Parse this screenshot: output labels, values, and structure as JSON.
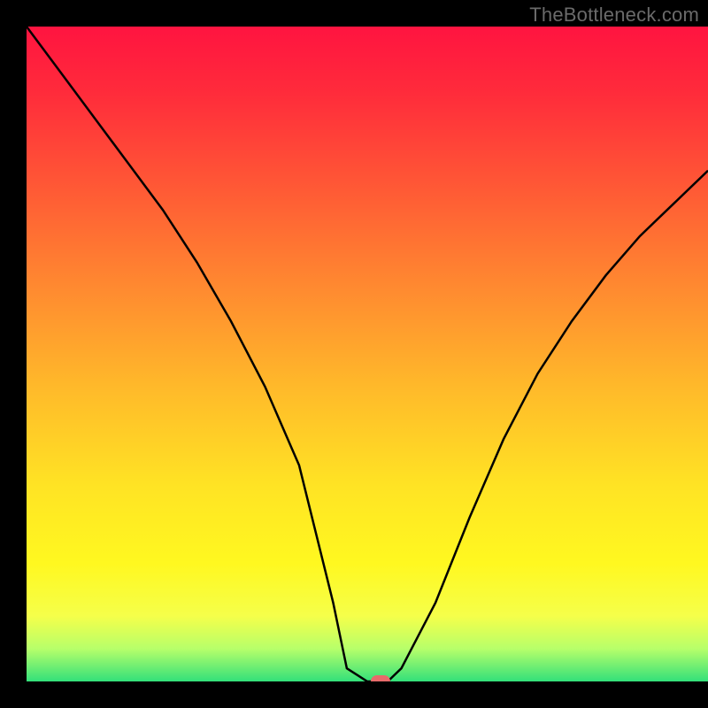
{
  "watermark": "TheBottleneck.com",
  "chart_data": {
    "type": "line",
    "title": "",
    "xlabel": "",
    "ylabel": "",
    "xlim": [
      0,
      100
    ],
    "ylim": [
      0,
      100
    ],
    "x": [
      0,
      5,
      10,
      15,
      20,
      25,
      30,
      35,
      40,
      45,
      47,
      50,
      53,
      55,
      58,
      60,
      65,
      70,
      75,
      80,
      85,
      90,
      95,
      100
    ],
    "values": [
      100,
      93,
      86,
      79,
      72,
      64,
      55,
      45,
      33,
      12,
      2,
      0,
      0,
      2,
      8,
      12,
      25,
      37,
      47,
      55,
      62,
      68,
      73,
      78
    ],
    "marker": {
      "x": 52,
      "y": 0
    },
    "gradient_stops": [
      {
        "pos": 0.0,
        "color": "#ff1440"
      },
      {
        "pos": 0.25,
        "color": "#ff5a35"
      },
      {
        "pos": 0.55,
        "color": "#ffb92a"
      },
      {
        "pos": 0.82,
        "color": "#fff820"
      },
      {
        "pos": 1.0,
        "color": "#33e07a"
      }
    ]
  }
}
